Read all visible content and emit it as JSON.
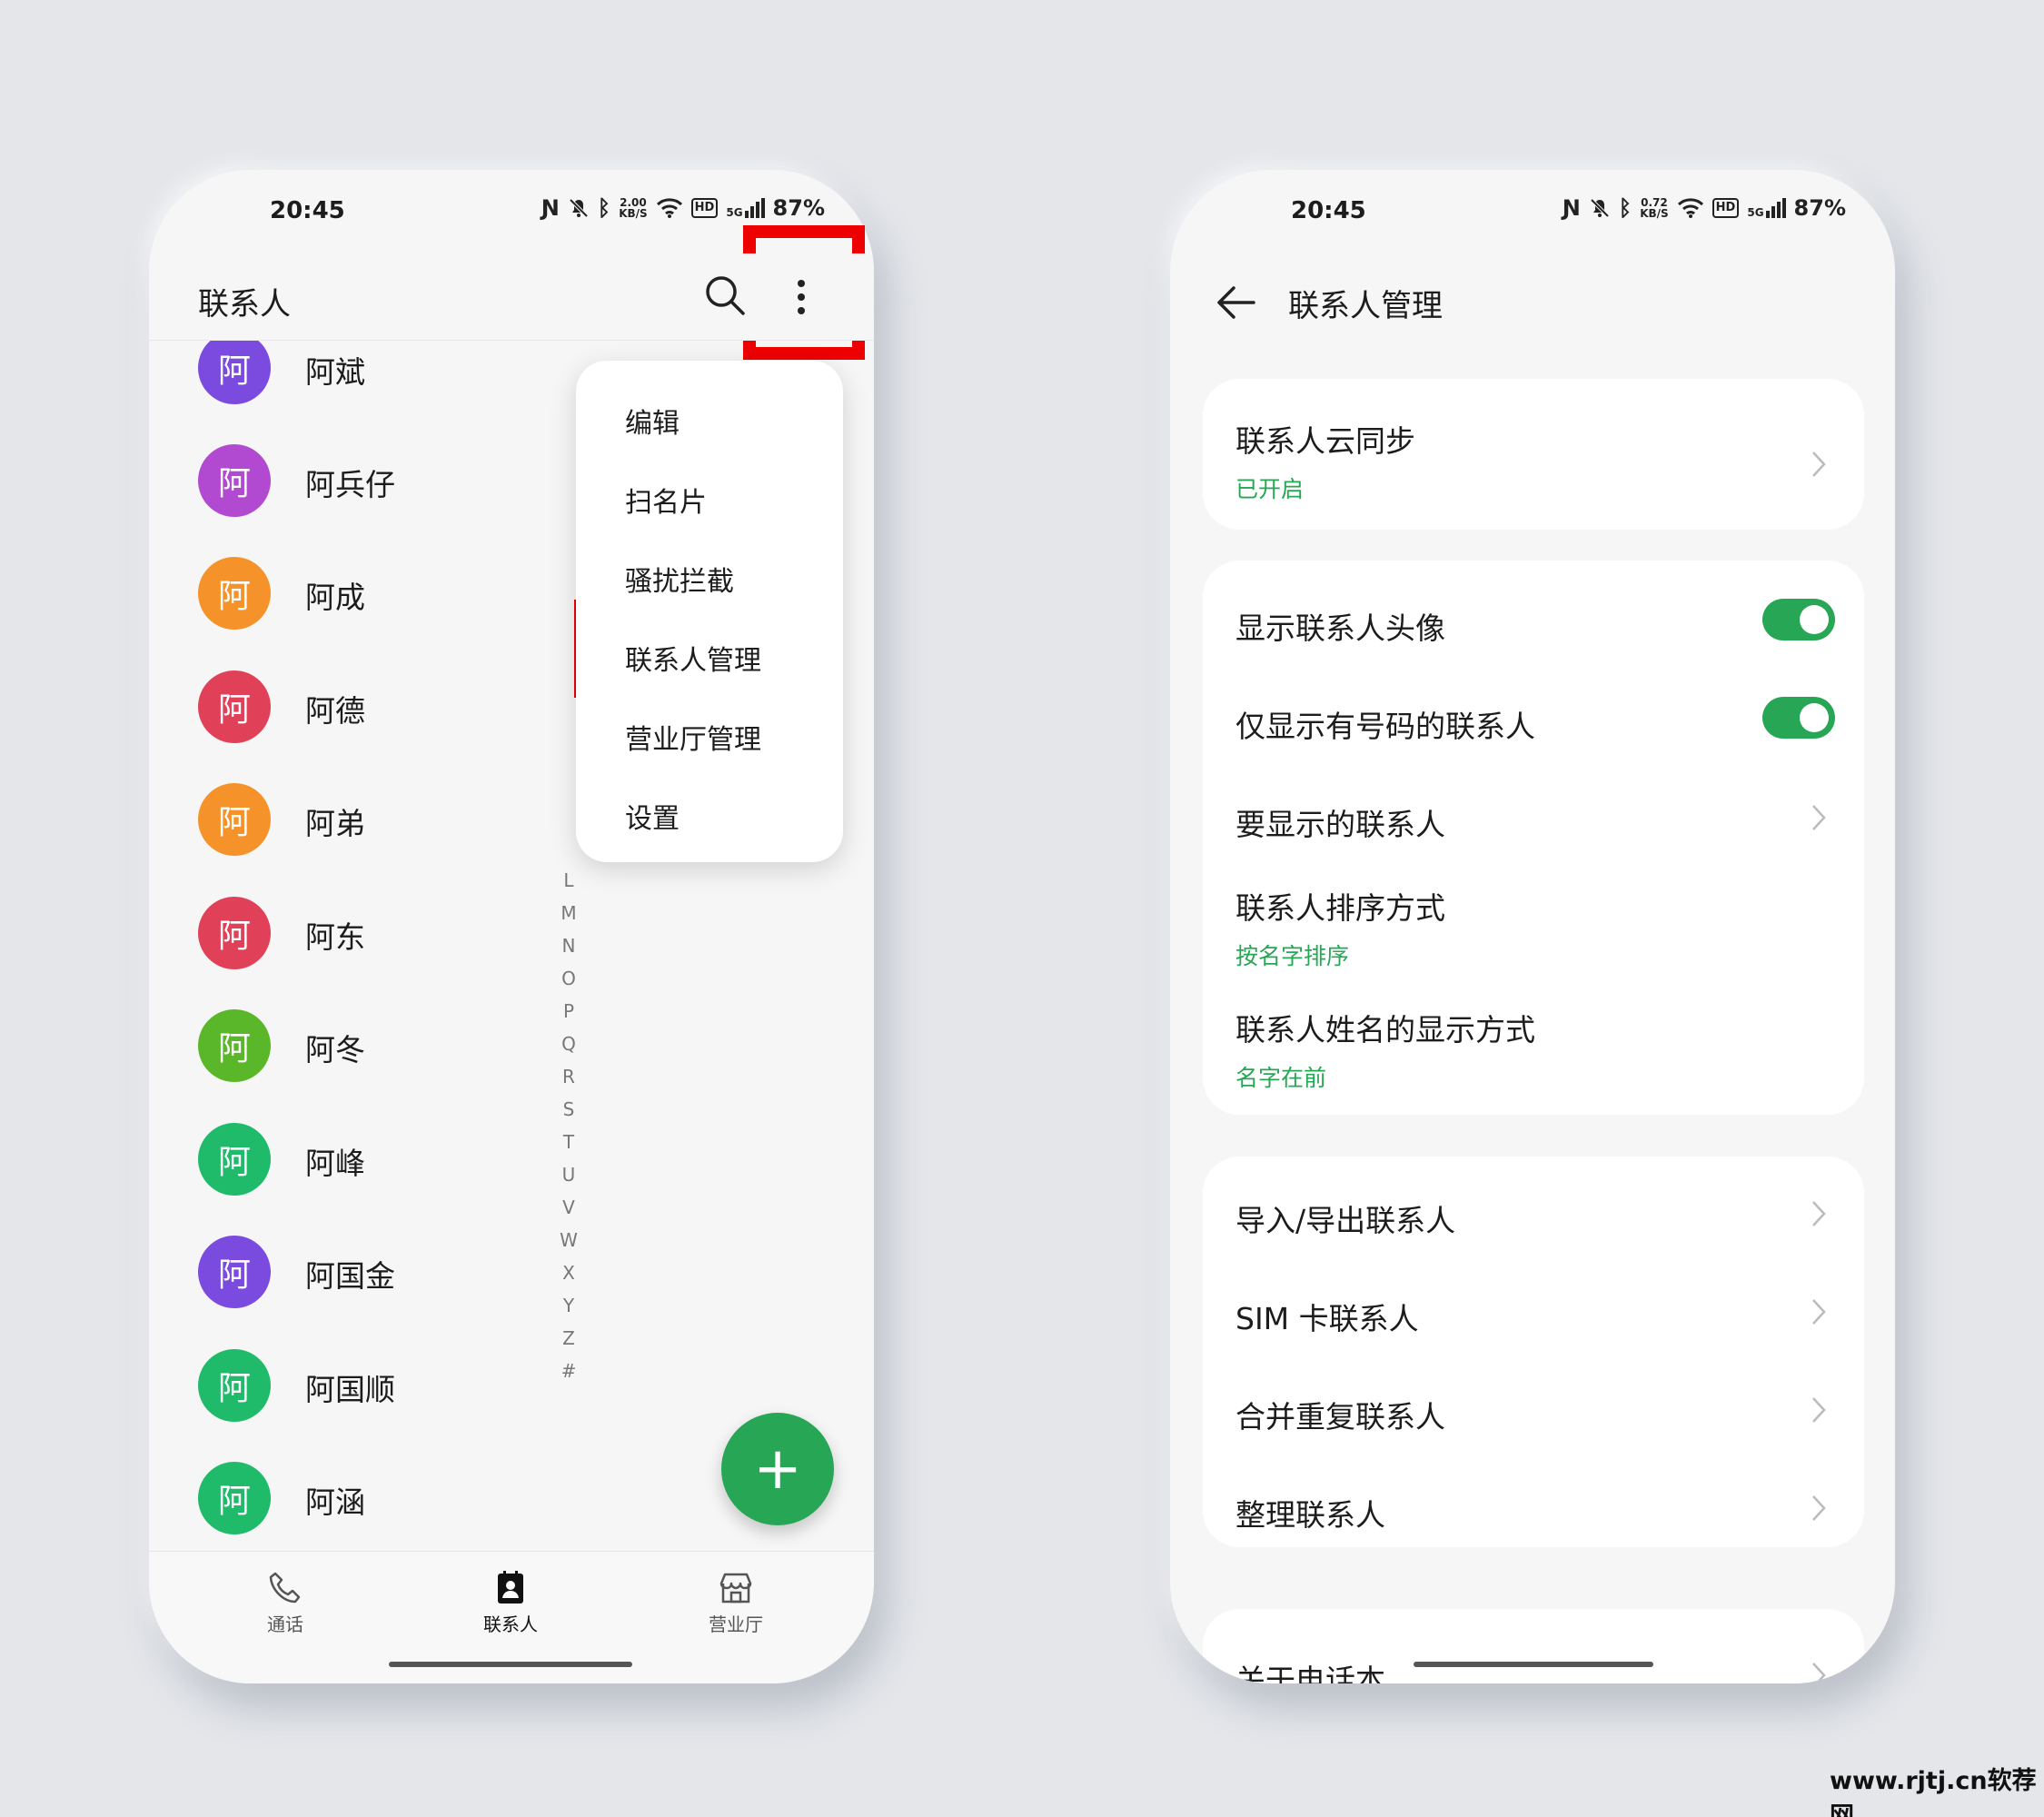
{
  "left_phone": {
    "status": {
      "time": "20:45",
      "speed_top": "2.00",
      "speed_unit": "KB/S",
      "hd": "HD",
      "net": "5G",
      "battery": "87%"
    },
    "title": "联系人",
    "contacts": [
      {
        "avatar": "阿",
        "name": "阿斌",
        "color": "#7b4be0"
      },
      {
        "avatar": "阿",
        "name": "阿兵仔",
        "color": "#b24ad1"
      },
      {
        "avatar": "阿",
        "name": "阿成",
        "color": "#f5922a"
      },
      {
        "avatar": "阿",
        "name": "阿德",
        "color": "#e04158"
      },
      {
        "avatar": "阿",
        "name": "阿弟",
        "color": "#f5922a"
      },
      {
        "avatar": "阿",
        "name": "阿东",
        "color": "#e04158"
      },
      {
        "avatar": "阿",
        "name": "阿冬",
        "color": "#5ab729"
      },
      {
        "avatar": "阿",
        "name": "阿峰",
        "color": "#1fbb6a"
      },
      {
        "avatar": "阿",
        "name": "阿国金",
        "color": "#7b4be0"
      },
      {
        "avatar": "阿",
        "name": "阿国顺",
        "color": "#1fbb6a"
      },
      {
        "avatar": "阿",
        "name": "阿涵",
        "color": "#1fbb6a"
      }
    ],
    "alphabet": [
      "L",
      "M",
      "N",
      "O",
      "P",
      "Q",
      "R",
      "S",
      "T",
      "U",
      "V",
      "W",
      "X",
      "Y",
      "Z",
      "#"
    ],
    "menu": [
      "编辑",
      "扫名片",
      "骚扰拦截",
      "联系人管理",
      "营业厅管理",
      "设置"
    ],
    "fab": "+",
    "nav": {
      "calls": "通话",
      "contacts": "联系人",
      "store": "营业厅"
    }
  },
  "right_phone": {
    "status": {
      "time": "20:45",
      "speed_top": "0.72",
      "speed_unit": "KB/S",
      "hd": "HD",
      "net": "5G",
      "battery": "87%"
    },
    "title": "联系人管理",
    "cloud_sync": {
      "label": "联系人云同步",
      "sub": "已开启"
    },
    "show_avatar": {
      "label": "显示联系人头像",
      "on": true
    },
    "only_with_number": {
      "label": "仅显示有号码的联系人",
      "on": true
    },
    "contacts_to_show": {
      "label": "要显示的联系人"
    },
    "sort_order": {
      "label": "联系人排序方式",
      "sub": "按名字排序"
    },
    "name_format": {
      "label": "联系人姓名的显示方式",
      "sub": "名字在前"
    },
    "import_export": {
      "label": "导入/导出联系人"
    },
    "sim": {
      "label": "SIM 卡联系人"
    },
    "merge": {
      "label": "合并重复联系人"
    },
    "organize": {
      "label": "整理联系人"
    },
    "about": {
      "label": "关于电话本"
    }
  },
  "watermark": "www.rjtj.cn软荐网",
  "colors": {
    "accent": "#27a655",
    "highlight": "#ee0000"
  }
}
